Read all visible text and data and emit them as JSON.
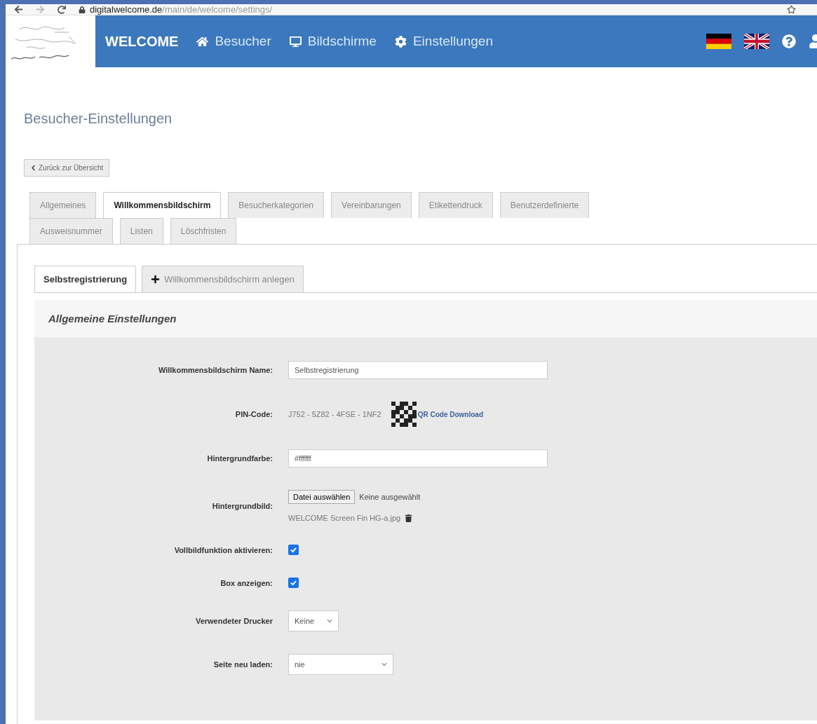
{
  "browser": {
    "url_host": "digitalwelcome.de",
    "url_path": "/main/de/welcome/settings/"
  },
  "navbar": {
    "brand": "WELCOME",
    "items": [
      {
        "label": "Besucher"
      },
      {
        "label": "Bildschirme"
      },
      {
        "label": "Einstellungen"
      }
    ]
  },
  "page_title": "Besucher-Einstellungen",
  "back_button": "Zurück zur Übersicht",
  "tab_rows": [
    [
      {
        "label": "Allgemeines",
        "selected": false
      },
      {
        "label": "Willkommensbildschirm",
        "selected": true
      },
      {
        "label": "Besucherkategorien",
        "selected": false
      },
      {
        "label": "Vereinbarungen",
        "selected": false
      },
      {
        "label": "Etikettendruck",
        "selected": false
      },
      {
        "label": "Benutzerdefinierte",
        "selected": false
      }
    ],
    [
      {
        "label": "Ausweisnummer",
        "selected": false
      },
      {
        "label": "Listen",
        "selected": false
      },
      {
        "label": "Löschfristen",
        "selected": false
      }
    ]
  ],
  "sub_tabs": [
    {
      "label": "Selbstregistrierung",
      "selected": true,
      "kind": "tab"
    },
    {
      "label": "Willkommensbildschirm anlegen",
      "selected": false,
      "kind": "add"
    }
  ],
  "section_title": "Allgemeine Einstellungen",
  "form": [
    {
      "kind": "text",
      "label": "Willkommensbildschirm Name:",
      "value": "Selbstregistrierung"
    },
    {
      "kind": "pin",
      "label": "PIN-Code:",
      "value": "J752 - 5Z82 - 4FSE - 1NF2",
      "link": "QR Code Download"
    },
    {
      "kind": "text",
      "label": "Hintergrundfarbe:",
      "value": "#ffffff"
    },
    {
      "kind": "file",
      "label": "Hintergrundbild:",
      "button": "Datei auswählen",
      "status": "Keine ausgewählt",
      "current": "WELCOME Screen Fin HG-a.jpg"
    },
    {
      "kind": "checkbox",
      "label": "Vollbildfunktion aktivieren:",
      "checked": true
    },
    {
      "kind": "checkbox",
      "label": "Box anzeigen:",
      "checked": true
    },
    {
      "kind": "select",
      "label": "Verwendeter Drucker",
      "value": "Keine"
    },
    {
      "kind": "select",
      "label": "Seite neu laden:",
      "value": "nie"
    }
  ]
}
